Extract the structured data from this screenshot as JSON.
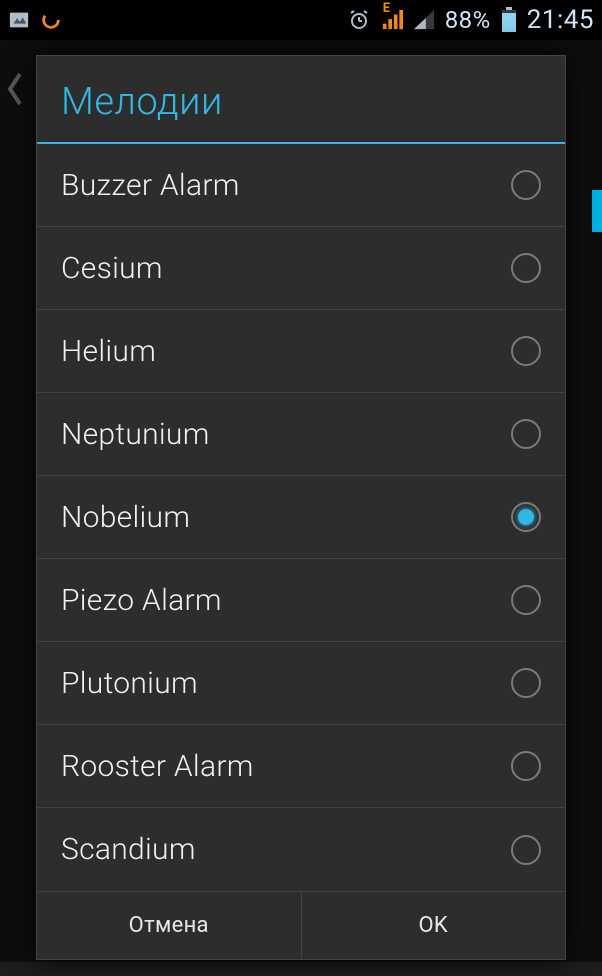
{
  "statusbar": {
    "battery_pct": "88%",
    "clock": "21:45",
    "network_label": "E"
  },
  "dialog": {
    "title": "Мелодии",
    "options": [
      {
        "label": "Buzzer Alarm",
        "selected": false
      },
      {
        "label": "Cesium",
        "selected": false
      },
      {
        "label": "Helium",
        "selected": false
      },
      {
        "label": "Neptunium",
        "selected": false
      },
      {
        "label": "Nobelium",
        "selected": true
      },
      {
        "label": "Piezo Alarm",
        "selected": false
      },
      {
        "label": "Plutonium",
        "selected": false
      },
      {
        "label": "Rooster Alarm",
        "selected": false
      },
      {
        "label": "Scandium",
        "selected": false
      }
    ],
    "buttons": {
      "cancel": "Отмена",
      "ok": "OK"
    }
  },
  "colors": {
    "accent": "#33b5e5"
  }
}
